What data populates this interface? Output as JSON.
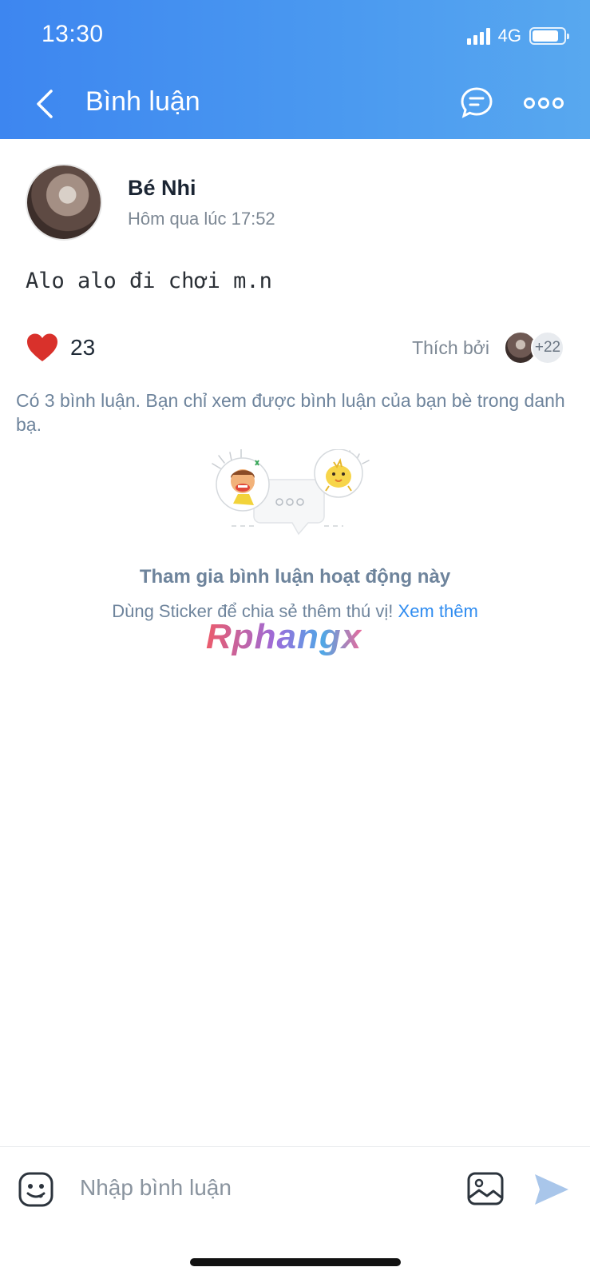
{
  "status_bar": {
    "time": "13:30",
    "network": "4G",
    "signal_bars": 4,
    "battery_level_pct": 85
  },
  "header": {
    "title": "Bình luận",
    "icons": {
      "back": "chevron-left-icon",
      "chat": "chat-bubble-icon",
      "more": "more-dots-icon"
    }
  },
  "post": {
    "author": "Bé Nhi",
    "time": "Hôm qua lúc 17:52",
    "text": "Alo alo đi chơi m.n",
    "like_count": "23",
    "liked_by_label": "Thích bởi",
    "more_likers": "+22"
  },
  "comments": {
    "notice": "Có 3 bình luận. Bạn chỉ xem được bình luận của bạn bè trong danh bạ.",
    "cta_title": "Tham gia bình luận hoạt động này",
    "cta_subtitle": "Dùng Sticker để chia sẻ thêm thú vị!",
    "cta_link": "Xem thêm"
  },
  "watermark": "Rphangx",
  "composer": {
    "placeholder": "Nhập bình luận",
    "icons": {
      "emoji": "emoji-icon",
      "image": "image-icon",
      "send": "send-icon"
    }
  },
  "colors": {
    "header_gradient_start": "#3d86f0",
    "header_gradient_end": "#58a8ef",
    "link": "#2f8cf0",
    "heart": "#d9312b",
    "muted": "#6e849c"
  }
}
